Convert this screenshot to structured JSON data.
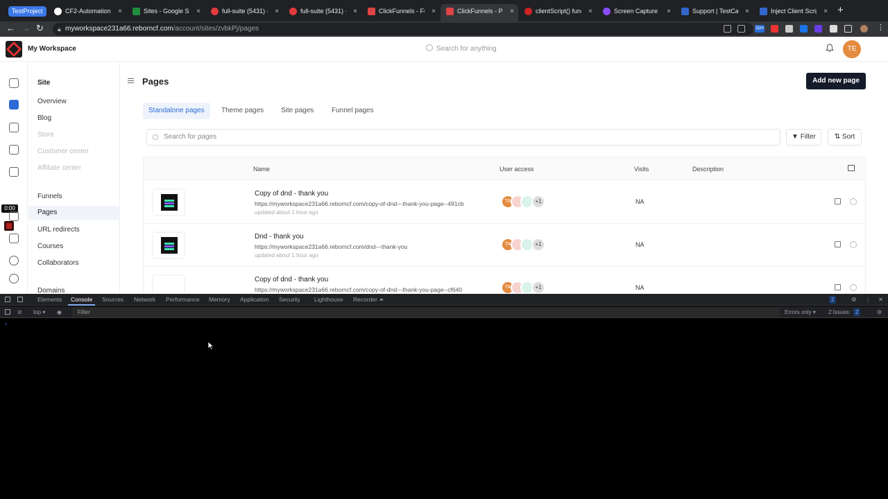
{
  "browser": {
    "profile_chip": "TestProject",
    "tabs": [
      {
        "label": "CF2-Automation",
        "color": "#ffffff"
      },
      {
        "label": "Sites - Google Sh",
        "color": "#1e8e3e"
      },
      {
        "label": "full-suite (5431) -",
        "color": "#e33b3b"
      },
      {
        "label": "full-suite (5431) -",
        "color": "#e33b3b"
      },
      {
        "label": "ClickFunnels - Fu",
        "color": "#d44"
      },
      {
        "label": "ClickFunnels - Pa",
        "color": "#d44"
      },
      {
        "label": "clientScript() func",
        "color": "#c22"
      },
      {
        "label": "Screen Capture o",
        "color": "#8a4dff"
      },
      {
        "label": "Support | TestCafe",
        "color": "#36c"
      },
      {
        "label": "Inject Client Scrip",
        "color": "#36c"
      }
    ],
    "close_glyph": "×",
    "new_tab": "+",
    "url_host": "myworkspace231a66.reborncf.com",
    "url_path": "/account/sites/zvbkPj/pages",
    "ext_badge": "2pm"
  },
  "app": {
    "workspace_name": "My Workspace",
    "search_placeholder": "Search for anything",
    "user_initials": "TE",
    "time_chip": "0:00"
  },
  "sidenav": {
    "heading": "Site",
    "items": [
      {
        "label": "Overview"
      },
      {
        "label": "Blog"
      },
      {
        "label": "Store"
      },
      {
        "label": "Customer center"
      },
      {
        "label": "Affiliate center"
      },
      {
        "label": "Funnels"
      },
      {
        "label": "Pages"
      },
      {
        "label": "URL redirects"
      },
      {
        "label": "Courses"
      },
      {
        "label": "Collaborators"
      },
      {
        "label": "Domains"
      }
    ]
  },
  "main": {
    "title": "Pages",
    "add_button": "Add new page",
    "tabs": [
      {
        "label": "Standalone pages"
      },
      {
        "label": "Theme pages"
      },
      {
        "label": "Site pages"
      },
      {
        "label": "Funnel pages"
      }
    ],
    "search_placeholder": "Search for pages",
    "filter_label": "Filter",
    "sort_label": "Sort",
    "columns": {
      "name": "Name",
      "user_access": "User access",
      "visits": "Visits",
      "description": "Description"
    },
    "rows": [
      {
        "title": "Copy of dnd - thank you",
        "url": "https://myworkspace231a66.reborncf.com/copy-of-dnd---thank-you-page--491cb",
        "updated": "updated about 1 hour ago",
        "avatar": "TA",
        "more": "+1",
        "visits": "NA"
      },
      {
        "title": "Dnd - thank you",
        "url": "https://myworkspace231a66.reborncf.com/dnd---thank-you",
        "updated": "updated about 1 hour ago",
        "avatar": "TA",
        "more": "+1",
        "visits": "NA"
      },
      {
        "title": "Copy of dnd - thank you",
        "url": "https://myworkspace231a66.reborncf.com/copy-of-dnd---thank-you-page--cf640",
        "updated": "",
        "avatar": "TA",
        "more": "+1",
        "visits": "NA"
      }
    ]
  },
  "devtools": {
    "tabs": [
      {
        "label": "Elements"
      },
      {
        "label": "Console"
      },
      {
        "label": "Sources"
      },
      {
        "label": "Network"
      },
      {
        "label": "Performance"
      },
      {
        "label": "Memory"
      },
      {
        "label": "Application"
      },
      {
        "label": "Security"
      },
      {
        "label": "Lighthouse"
      },
      {
        "label": "Recorder ⏶"
      }
    ],
    "context": "top ▾",
    "filter_placeholder": "Filter",
    "levels": "Errors only ▾",
    "issues": "2 Issues:",
    "issue_count": "2",
    "msg_count": "2",
    "prompt": "›"
  }
}
